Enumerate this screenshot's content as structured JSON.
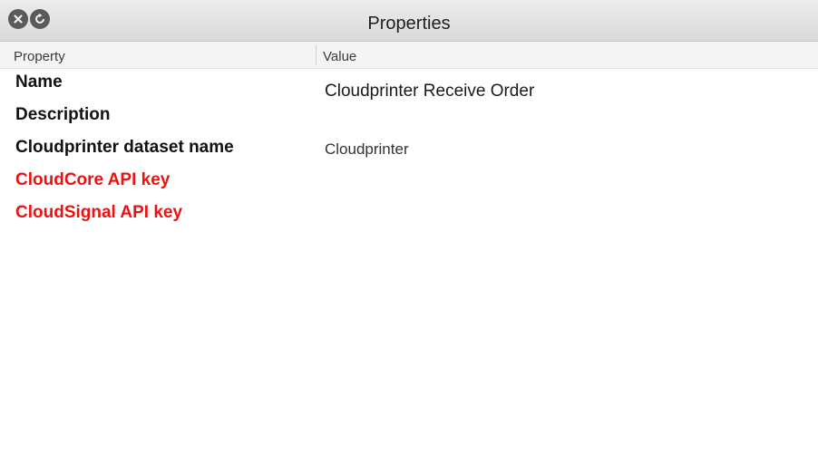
{
  "window": {
    "title": "Properties",
    "close_button": "close-icon",
    "refresh_button": "refresh-icon"
  },
  "table": {
    "columns": {
      "property": "Property",
      "value": "Value"
    },
    "rows": [
      {
        "property": "Name",
        "value": "Cloudprinter Receive Order",
        "required_missing": false
      },
      {
        "property": "Description",
        "value": "",
        "required_missing": false
      },
      {
        "property": "Cloudprinter dataset name",
        "value": "Cloudprinter",
        "required_missing": false
      },
      {
        "property": "CloudCore API key",
        "value": "",
        "required_missing": true
      },
      {
        "property": "CloudSignal API key",
        "value": "",
        "required_missing": true
      }
    ]
  },
  "colors": {
    "error_text": "#ee1111",
    "normal_text": "#111111"
  }
}
